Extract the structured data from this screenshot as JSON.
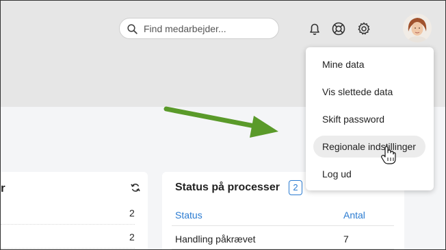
{
  "search": {
    "placeholder": "Find medarbejder..."
  },
  "header_icons": [
    "bell-icon",
    "lifebuoy-icon",
    "gear-icon"
  ],
  "user_menu": {
    "items": [
      {
        "label": "Mine data"
      },
      {
        "label": "Vis slettede data"
      },
      {
        "label": "Skift password"
      },
      {
        "label": "Regionale indstillinger",
        "hovered": true
      },
      {
        "label": "Log ud"
      }
    ]
  },
  "left_card": {
    "title_fragment": "r",
    "values": [
      "2",
      "2"
    ]
  },
  "process_card": {
    "title": "Status på processer",
    "count": "2",
    "columns": {
      "status": "Status",
      "count": "Antal"
    },
    "rows": [
      {
        "status": "Handling påkrævet",
        "count": "7"
      }
    ]
  },
  "colors": {
    "accent": "#2a7bd1",
    "annotation_arrow": "#5a9a2a"
  }
}
